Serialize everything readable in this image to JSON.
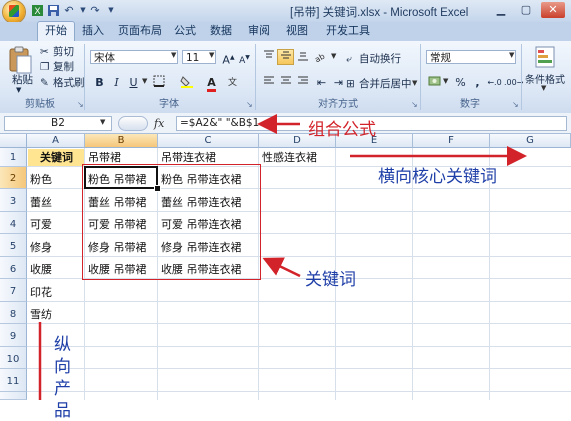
{
  "titlebar": {
    "title": "[吊带] 关键词.xlsx - Microsoft Excel"
  },
  "tabs": [
    "开始",
    "插入",
    "页面布局",
    "公式",
    "数据",
    "审阅",
    "视图",
    "开发工具"
  ],
  "ribbon": {
    "clipboard": {
      "paste": "粘贴",
      "cut": "剪切",
      "copy": "复制",
      "format_painter": "格式刷",
      "label": "剪贴板"
    },
    "font": {
      "name": "宋体",
      "size": "11",
      "label": "字体",
      "bold": "B",
      "italic": "I",
      "underline": "U"
    },
    "alignment": {
      "wrap": "自动换行",
      "merge": "合并后居中",
      "label": "对齐方式"
    },
    "number": {
      "format": "常规",
      "label": "数字",
      "percent": "%",
      "comma": ","
    },
    "styles": {
      "conditional": "条件格式"
    }
  },
  "formula_bar": {
    "name_box": "B2",
    "fx": "fx",
    "formula": "=$A2&\" \"&B$1"
  },
  "columns": [
    "A",
    "B",
    "C",
    "D",
    "E",
    "F",
    "G"
  ],
  "rows": [
    "1",
    "2",
    "3",
    "4",
    "5",
    "6",
    "7",
    "8",
    "9",
    "10",
    "11"
  ],
  "cells": {
    "A": [
      "关键词",
      "粉色",
      "蕾丝",
      "可爱",
      "修身",
      "收腰",
      "印花",
      "雪纺"
    ],
    "header": [
      "吊带裙",
      "吊带连衣裙",
      "性感连衣裙"
    ],
    "B": [
      "粉色 吊带裙",
      "蕾丝 吊带裙",
      "可爱 吊带裙",
      "修身 吊带裙",
      "收腰 吊带裙"
    ],
    "C": [
      "粉色 吊带连衣裙",
      "蕾丝 吊带连衣裙",
      "可爱 吊带连衣裙",
      "修身 吊带连衣裙",
      "收腰 吊带连衣裙"
    ]
  },
  "annotations": {
    "formula": "组合公式",
    "horizontal": "横向核心关键词",
    "keywords": "关键词",
    "vertical": [
      "纵",
      "向",
      "产",
      "品"
    ]
  },
  "colors": {
    "annotation_red": "#d2232a",
    "annotation_blue": "#1f3fa8",
    "ribbon_bg": "#dce7f5",
    "selected_header": "#f5c77a"
  }
}
